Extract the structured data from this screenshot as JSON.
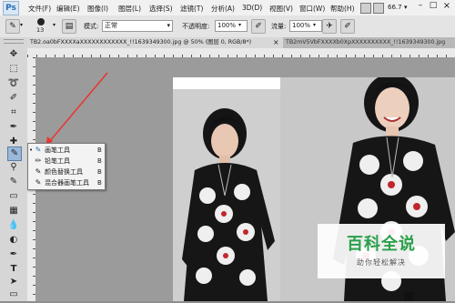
{
  "menubar": {
    "app_logo": "Ps",
    "items": [
      "文件(F)",
      "编辑(E)",
      "图像(I)",
      "图层(L)",
      "选择(S)",
      "滤镜(T)",
      "分析(A)",
      "3D(D)",
      "视图(V)",
      "窗口(W)",
      "帮助(H)"
    ],
    "zoom": "66.7",
    "window_controls": [
      "–",
      "□",
      "×"
    ]
  },
  "options": {
    "brush_size": "13",
    "mode_label": "模式:",
    "mode_value": "正常",
    "opacity_label": "不透明度:",
    "opacity_value": "100%",
    "flow_label": "流量:",
    "flow_value": "100%"
  },
  "tabs": [
    {
      "label": "TB2.oa0bFXXXXaXXXXXXXXXXXX_!!1639349300.jpg @ 50% (图层 0, RGB/8*)",
      "close": "×"
    },
    {
      "label": "TB2mV5VbFXXXXb0XpXXXXXXXXXX_!!1639349300.jpg"
    }
  ],
  "flyout": [
    {
      "icon": "brush-icon",
      "glyph": "✎",
      "label": "画笔工具",
      "key": "B",
      "active": true
    },
    {
      "icon": "pencil-icon",
      "glyph": "✏",
      "label": "铅笔工具",
      "key": "B"
    },
    {
      "icon": "color-replace-icon",
      "glyph": "✎",
      "label": "颜色替换工具",
      "key": "B"
    },
    {
      "icon": "mixer-brush-icon",
      "glyph": "✎",
      "label": "混合器画笔工具",
      "key": "B"
    }
  ],
  "watermark": {
    "title": "百科全说",
    "subtitle": "助你轻松解决",
    "color": "#2aa04a"
  },
  "colors": {
    "arrow": "#e53935",
    "highlight": "#2a6fb5"
  }
}
